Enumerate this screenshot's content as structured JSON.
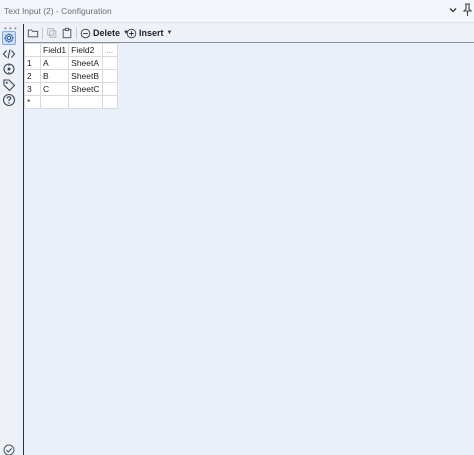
{
  "window": {
    "title": "Text Input (2) - Configuration"
  },
  "rail": {
    "items": [
      {
        "icon": "gear-icon",
        "active": true
      },
      {
        "icon": "code-icon",
        "active": false
      },
      {
        "icon": "connection-icon",
        "active": false
      },
      {
        "icon": "tag-icon",
        "active": false
      },
      {
        "icon": "help-icon",
        "active": false
      }
    ],
    "overflow": "• • •"
  },
  "toolbar": {
    "delete_label": "Delete",
    "insert_label": "Insert",
    "caret": "▼"
  },
  "grid": {
    "columns": [
      "Field1",
      "Field2",
      "..."
    ],
    "rows": [
      {
        "num": "1",
        "field1": "A",
        "field2": "SheetA"
      },
      {
        "num": "2",
        "field1": "B",
        "field2": "SheetB"
      },
      {
        "num": "3",
        "field1": "C",
        "field2": "SheetC"
      }
    ],
    "new_row_marker": "*"
  },
  "colors": {
    "background": "#eaf0f9",
    "accent": "#2f6fd6"
  }
}
